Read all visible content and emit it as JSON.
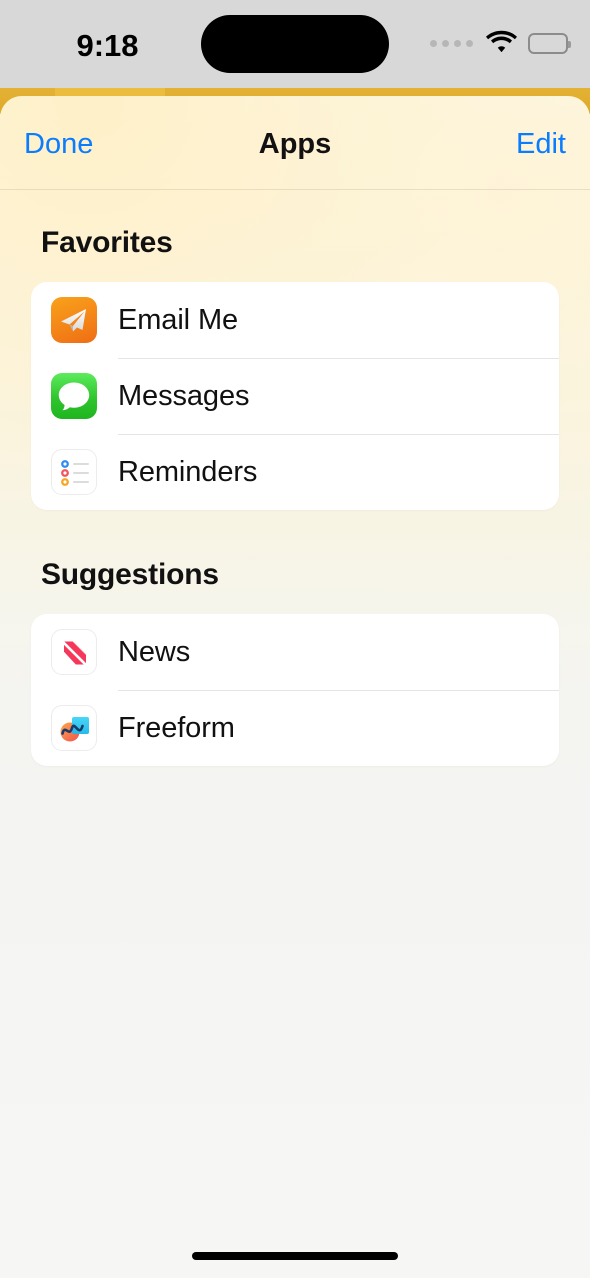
{
  "status_bar": {
    "time": "9:18",
    "signal_icon": "signal-dots-icon",
    "wifi_icon": "wifi-icon",
    "battery_icon": "battery-full-icon"
  },
  "nav_bar": {
    "left_button": "Done",
    "title": "Apps",
    "right_button": "Edit"
  },
  "sections": [
    {
      "header": "Favorites",
      "items": [
        {
          "label": "Email Me",
          "icon": "email-me-app-icon"
        },
        {
          "label": "Messages",
          "icon": "messages-app-icon"
        },
        {
          "label": "Reminders",
          "icon": "reminders-app-icon"
        }
      ]
    },
    {
      "header": "Suggestions",
      "items": [
        {
          "label": "News",
          "icon": "news-app-icon"
        },
        {
          "label": "Freeform",
          "icon": "freeform-app-icon"
        }
      ]
    }
  ],
  "colors": {
    "accent_blue": "#0a7cff",
    "gold_strip": "#dfa929",
    "sheet_cream": "#fdf6e1",
    "card_white": "#ffffff",
    "separator": "#e4e4e4",
    "status_bar_bg": "#d8d8d8",
    "email_orange": "#f58b18",
    "messages_green": "#30c52f",
    "news_red": "#f5375a",
    "reminders_blue": "#2e8cf0",
    "reminders_red": "#f2555a",
    "reminders_orange": "#f5a623",
    "freeform_cyan": "#2fc9f0",
    "freeform_orange": "#f97b4e"
  },
  "home_indicator": "home-indicator"
}
